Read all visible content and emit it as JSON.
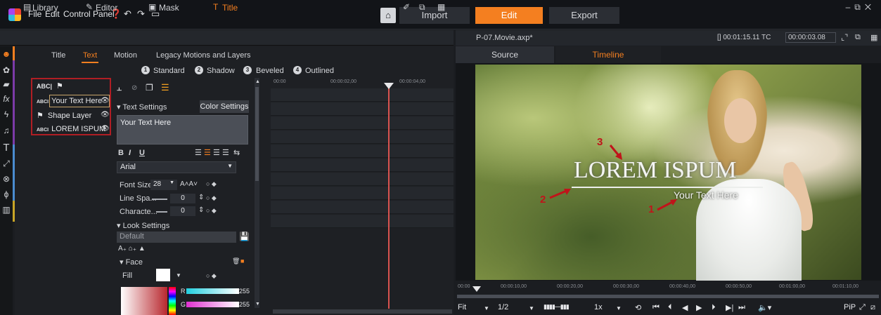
{
  "menu": {
    "file": "File",
    "edit": "Edit",
    "control_panel": "Control Panel"
  },
  "modes": {
    "import": "Import",
    "edit": "Edit",
    "export": "Export"
  },
  "subtabs": {
    "library": "Library",
    "editor": "Editor",
    "mask": "Mask",
    "title": "Title"
  },
  "editor_tabs": {
    "title": "Title",
    "text": "Text",
    "motion": "Motion",
    "legacy": "Legacy Motions and Layers"
  },
  "presets": [
    {
      "num": "1",
      "label": "Standard"
    },
    {
      "num": "2",
      "label": "Shadow"
    },
    {
      "num": "3",
      "label": "Beveled"
    },
    {
      "num": "4",
      "label": "Outlined"
    }
  ],
  "layers": {
    "header_abc": "ABC|",
    "items": [
      {
        "label": "Your Text Here",
        "abc": "ABCI"
      },
      {
        "label": "Shape Layer",
        "abc": ""
      },
      {
        "label": "LOREM ISPUM",
        "abc": "ABCI"
      }
    ]
  },
  "text_settings": {
    "header": "Text Settings",
    "color_settings": "Color Settings",
    "text_value": "Your Text Here",
    "bold": "B",
    "italic": "I",
    "underline": "U",
    "font": "Arial",
    "font_size_label": "Font Size",
    "font_size_value": "28",
    "line_spacing_label": "Line Spa...",
    "line_spacing_value": "0",
    "char_label": "Characte...",
    "char_value": "0"
  },
  "look_settings": {
    "header": "Look Settings",
    "default": "Default",
    "face": "Face",
    "fill": "Fill",
    "r_label": "R",
    "g_label": "G",
    "r_value": "255",
    "g_value": "255"
  },
  "timeline_mini": {
    "t0": "00:00",
    "t1": "00:00:02,00",
    "t2": "00:00:04,00"
  },
  "preview": {
    "file_title": "P-07.Movie.axp*",
    "duration": "[] 00:01:15.11  TC",
    "timecode": "00:00:03.08",
    "source_tab": "Source",
    "timeline_tab": "Timeline",
    "title_main": "LOREM ISPUM",
    "title_sub": "Your Text Here",
    "anno1": "1",
    "anno2": "2",
    "anno3": "3"
  },
  "scrubber": [
    "00:00",
    "00:00:10,00",
    "00:00:20,00",
    "00:00:30,00",
    "00:00:40,00",
    "00:00:50,00",
    "00:01:00,00",
    "00:01:10,00"
  ],
  "transport": {
    "fit": "Fit",
    "ratio": "1/2",
    "speed": "1x",
    "pip": "PiP"
  },
  "colors": {
    "accent": "#f47f20",
    "highlight_border": "#b01e24",
    "playhead": "#d9534f"
  },
  "icons": [
    "app-logo-icon",
    "help-icon",
    "undo-icon",
    "redo-icon",
    "save-icon",
    "home-icon",
    "minimize-icon",
    "maximize-icon",
    "close-icon"
  ]
}
